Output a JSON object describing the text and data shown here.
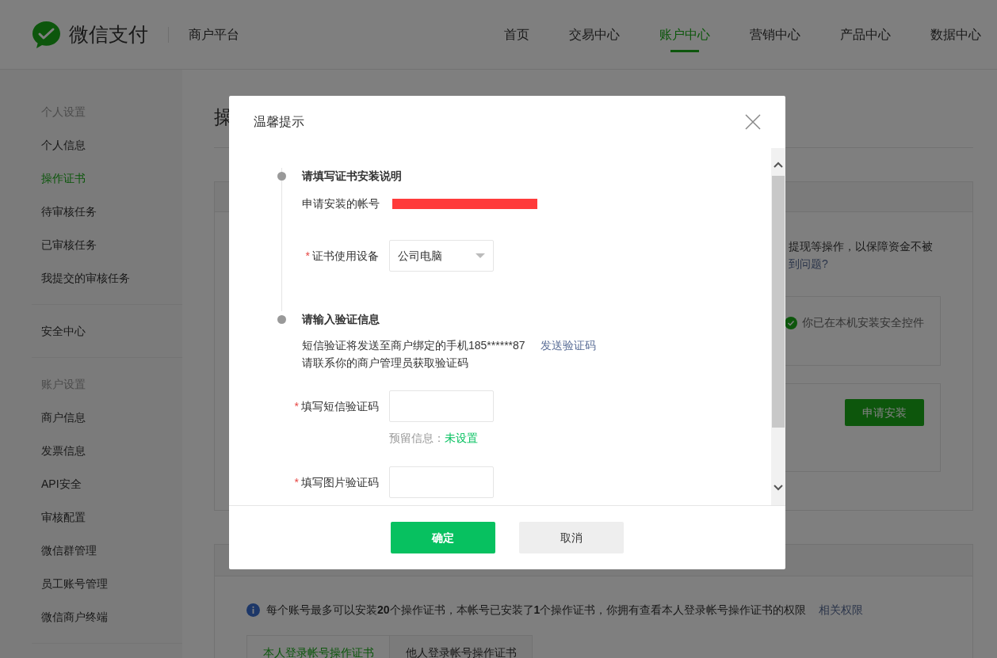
{
  "header": {
    "brand": "微信支付",
    "platform": "商户平台",
    "nav": [
      {
        "label": "首页",
        "selected": false
      },
      {
        "label": "交易中心",
        "selected": false
      },
      {
        "label": "账户中心",
        "selected": true
      },
      {
        "label": "营销中心",
        "selected": false
      },
      {
        "label": "产品中心",
        "selected": false
      },
      {
        "label": "数据中心",
        "selected": false
      }
    ]
  },
  "sidebar": {
    "groups": [
      {
        "heading": "个人设置",
        "items": [
          {
            "label": "个人信息",
            "selected": false
          },
          {
            "label": "操作证书",
            "selected": true
          },
          {
            "label": "待审核任务",
            "selected": false
          },
          {
            "label": "已审核任务",
            "selected": false
          },
          {
            "label": "我提交的审核任务",
            "selected": false
          }
        ]
      },
      {
        "items": [
          {
            "label": "安全中心",
            "selected": false
          }
        ]
      },
      {
        "heading": "账户设置",
        "items": [
          {
            "label": "商户信息",
            "selected": false
          },
          {
            "label": "发票信息",
            "selected": false
          },
          {
            "label": "API安全",
            "selected": false
          },
          {
            "label": "审核配置",
            "selected": false
          },
          {
            "label": "微信群管理",
            "selected": false
          },
          {
            "label": "员工账号管理",
            "selected": false
          },
          {
            "label": "微信商户终端",
            "selected": false
          }
        ]
      }
    ]
  },
  "page": {
    "title": "操",
    "notice": "提现等操作，以保障资金不被",
    "help_link": "到问题?",
    "control_status": "你已在本机安装安全控件",
    "apply_button": "申请安装",
    "info": "每个账号最多可以安装**20**个操作证书，本帐号已安装了**1**个操作证书，你拥有查看本人登录帐号操作证书的权限",
    "info_link": "相关权限",
    "tabs": [
      {
        "label": "本人登录帐号操作证书",
        "selected": true
      },
      {
        "label": "他人登录帐号操作证书",
        "selected": false
      }
    ]
  },
  "dialog": {
    "title": "温馨提示",
    "step_1": {
      "title": "请填写证书安装说明",
      "account_label": "申请安装的帐号",
      "device": {
        "required_mark": "*",
        "label": "证书使用设备",
        "value": "公司电脑"
      }
    },
    "step_2": {
      "title": "请输入验证信息",
      "sms_notice": "短信验证将发送至商户绑定的手机185******87",
      "send_code_link": "发送验证码",
      "contact_note": "请联系你的商户管理员获取验证码",
      "sms_code": {
        "required_mark": "*",
        "label": "填写短信验证码"
      },
      "reserved_label": "预留信息：",
      "reserved_value": "未设置",
      "image_code": {
        "required_mark": "*",
        "label": "填写图片验证码"
      }
    },
    "confirm_button": "确定",
    "cancel_button": "取消"
  }
}
